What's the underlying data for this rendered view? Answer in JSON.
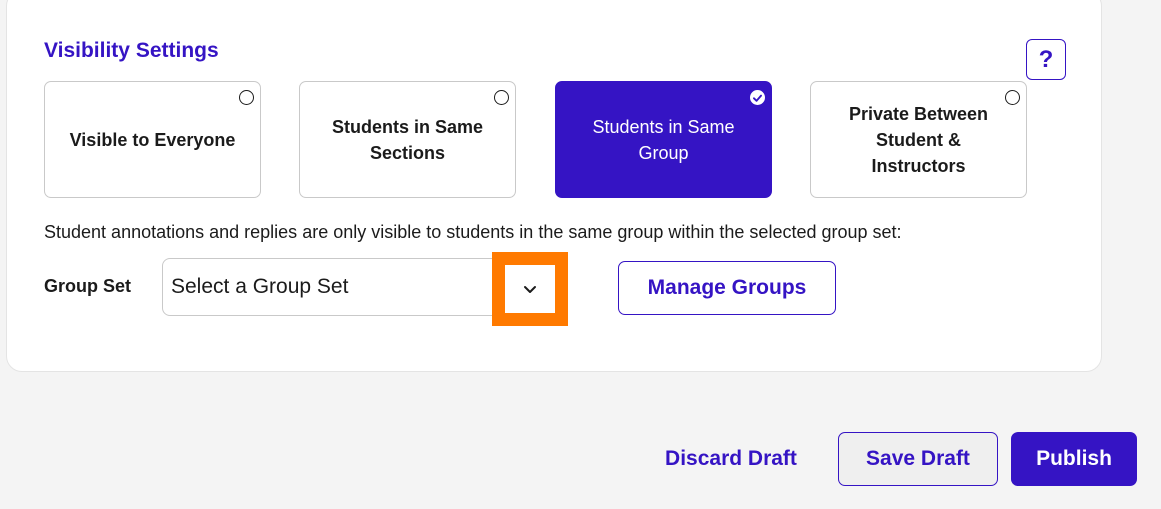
{
  "visibility": {
    "title": "Visibility Settings",
    "help_label": "?",
    "options": [
      {
        "label": "Visible to Everyone",
        "selected": false
      },
      {
        "label": "Students in Same Sections",
        "selected": false
      },
      {
        "label": "Students in Same Group",
        "selected": true
      },
      {
        "label": "Private Between Student & Instructors",
        "selected": false
      }
    ],
    "description": "Student annotations and replies are only visible to students in the same group within the selected group set:",
    "group_set": {
      "label": "Group Set",
      "value": "Select a Group Set",
      "dropdown_icon": "chevron-down-icon"
    },
    "manage_groups_label": "Manage Groups"
  },
  "footer": {
    "discard_label": "Discard Draft",
    "save_label": "Save Draft",
    "publish_label": "Publish"
  },
  "colors": {
    "accent": "#3514c4",
    "highlight": "#ff7a00",
    "background": "#f4f4f4"
  }
}
